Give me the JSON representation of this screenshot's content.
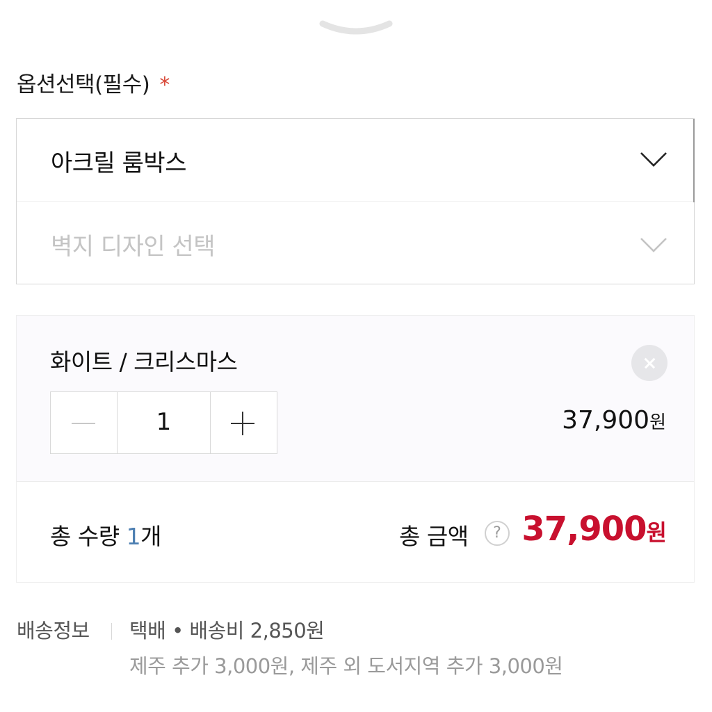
{
  "sheet": {
    "handle_icon": "chevron-down-handle-icon"
  },
  "options": {
    "title": "옵션선택(필수)",
    "required_mark": "*",
    "primary_select": {
      "value": "아크릴 룸박스",
      "icon": "chevron-down-icon"
    },
    "secondary_select": {
      "placeholder": "벽지 디자인 선택",
      "icon": "chevron-down-icon"
    }
  },
  "selected_item": {
    "name": "화이트 / 크리스마스",
    "remove_icon": "close-icon",
    "quantity": "1",
    "price": "37,900",
    "currency": "원"
  },
  "totals": {
    "quantity_label": "총 수량",
    "quantity_value": "1",
    "quantity_unit": "개",
    "amount_label": "총 금액",
    "help_icon": "question-icon",
    "help_glyph": "?",
    "amount": "37,900",
    "currency": "원"
  },
  "shipping": {
    "label": "배송정보",
    "method": "택배 • 배송비 2,850원",
    "extra": "제주 추가 3,000원, 제주 외 도서지역 추가 3,000원"
  },
  "colors": {
    "accent_price": "#c8102e",
    "required_star": "#d94a3a",
    "qty_highlight": "#4d7fb2"
  }
}
